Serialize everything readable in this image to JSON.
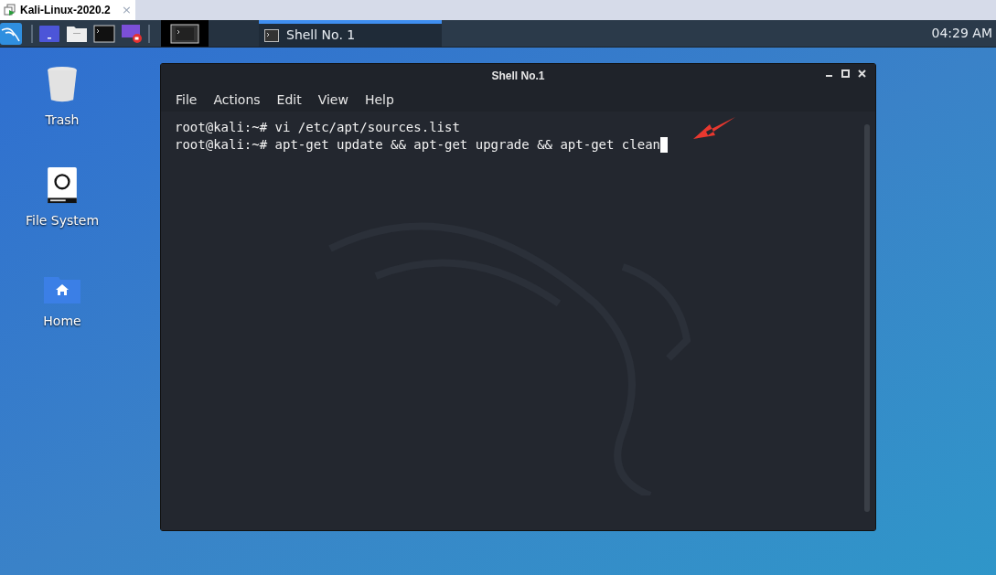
{
  "vm_tab": {
    "title": "Kali-Linux-2020.2",
    "close": "×"
  },
  "taskbar": {
    "tasks": [
      {
        "title": "Shell No. 1",
        "selected": true
      }
    ],
    "clock": "04:29 AM"
  },
  "desktop_icons": [
    {
      "kind": "trash",
      "label": "Trash"
    },
    {
      "kind": "drive",
      "label": "File System"
    },
    {
      "kind": "home",
      "label": "Home"
    }
  ],
  "terminal": {
    "title": "Shell No.1",
    "menu": [
      "File",
      "Actions",
      "Edit",
      "View",
      "Help"
    ],
    "lines": [
      "root@kali:~# vi /etc/apt/sources.list",
      "root@kali:~# apt-get update && apt-get upgrade && apt-get clean"
    ]
  }
}
